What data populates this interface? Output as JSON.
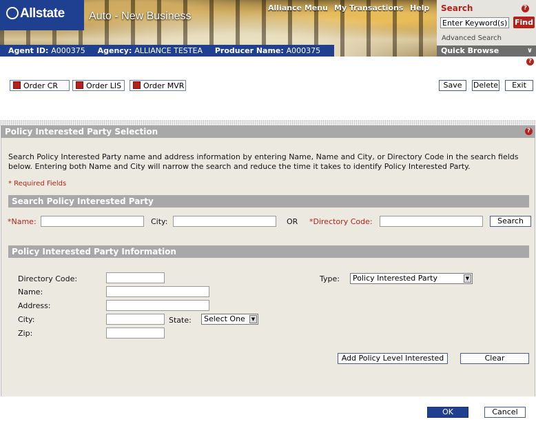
{
  "header": {
    "logo": "Allstate",
    "app_title": "Auto - New Business",
    "nav": [
      "Alliance Menu",
      "My Transactions",
      "Help"
    ],
    "agent_id_label": "Agent ID:",
    "agent_id": "A000375",
    "agency_label": "Agency:",
    "agency": "ALLIANCE TESTEA",
    "producer_label": "Producer Name:",
    "producer": "A000375"
  },
  "search": {
    "title": "Search",
    "keyword_value": "Enter Keyword(s)",
    "find": "Find",
    "advanced": "Advanced Search",
    "quick_browse": "Quick Browse"
  },
  "toolbar": {
    "order_cr": "Order CR",
    "order_lis": "Order LIS",
    "order_mvr": "Order MVR",
    "save": "Save",
    "delete": "Delete",
    "exit": "Exit"
  },
  "page": {
    "section_title": "Policy Interested Party Selection",
    "intro": "Search Policy Interested Party name and address information by entering Name, Name and City, or Directory Code in the search fields below. Entering both Name and City will narrow the search and reduce the time it takes to identify Policy Interested Party.",
    "required_note": "* Required Fields"
  },
  "search_section": {
    "title": "Search Policy Interested Party",
    "name_label": "*Name:",
    "city_label": "City:",
    "or": "OR",
    "dir_code_label": "*Directory Code:",
    "search_button": "Search"
  },
  "info_section": {
    "title": "Policy Interested Party Information",
    "directory_code_label": "Directory Code:",
    "name_label": "Name:",
    "address_label": "Address:",
    "city_label": "City:",
    "state_label": "State:",
    "state_value": "Select One",
    "zip_label": "Zip:",
    "type_label": "Type:",
    "type_value": "Policy Interested Party",
    "add_button": "Add Policy Level Interested",
    "clear_button": "Clear"
  },
  "footer": {
    "ok": "OK",
    "cancel": "Cancel"
  },
  "colors": {
    "brand_blue": "#1f3f90",
    "accent_red": "#b5221c",
    "panel_bg": "#eceae0",
    "section_gray": "#a8a8a8"
  }
}
